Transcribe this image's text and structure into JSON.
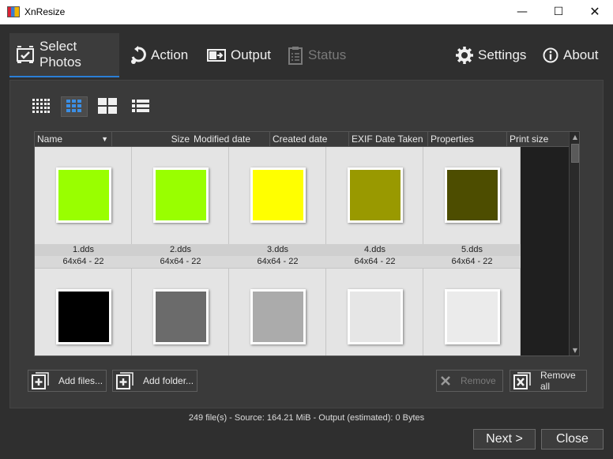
{
  "window": {
    "title": "XnResize",
    "minimize": "—",
    "maximize": "☐",
    "close": "✕"
  },
  "tabs": {
    "select_photos": "Select Photos",
    "action": "Action",
    "output": "Output",
    "status": "Status",
    "settings": "Settings",
    "about": "About"
  },
  "columns": {
    "name": "Name",
    "size": "Size",
    "modified": "Modified date",
    "created": "Created date",
    "exif": "EXIF Date Taken",
    "properties": "Properties",
    "print_size": "Print size"
  },
  "files": [
    {
      "name": "1.dds",
      "dims": "64x64 - 22",
      "color": "#99ff00"
    },
    {
      "name": "2.dds",
      "dims": "64x64 - 22",
      "color": "#99ff00"
    },
    {
      "name": "3.dds",
      "dims": "64x64 - 22",
      "color": "#ffff00"
    },
    {
      "name": "4.dds",
      "dims": "64x64 - 22",
      "color": "#999900"
    },
    {
      "name": "5.dds",
      "dims": "64x64 - 22",
      "color": "#4d4d00"
    },
    {
      "name": "",
      "dims": "",
      "color": "#000000"
    },
    {
      "name": "",
      "dims": "",
      "color": "#6b6b6b"
    },
    {
      "name": "",
      "dims": "",
      "color": "#ababab"
    },
    {
      "name": "",
      "dims": "",
      "color": "#e6e6e6"
    },
    {
      "name": "",
      "dims": "",
      "color": "#ebebeb"
    }
  ],
  "buttons": {
    "add_files": "Add files...",
    "add_folder": "Add folder...",
    "remove": "Remove",
    "remove_all": "Remove all",
    "next": "Next >",
    "close": "Close"
  },
  "status_line": "249 file(s) - Source: 164.21 MiB - Output (estimated): 0 Bytes",
  "colors": {
    "accent": "#2b7fd6"
  }
}
